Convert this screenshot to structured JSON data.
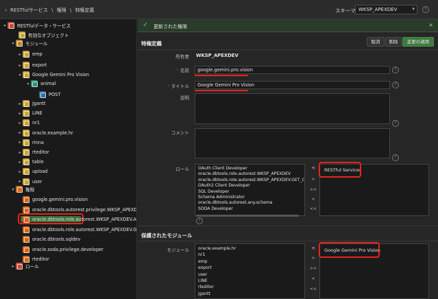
{
  "breadcrumb": {
    "items": [
      "RESTfulサービス",
      "権限",
      "特権定義"
    ]
  },
  "schema": {
    "label": "スキーマ",
    "value": "WKSP_APEXDEV"
  },
  "tree": {
    "root": "RESTfulデータ・サービス",
    "enabled_objects": "有効なオブジェクト",
    "modules_label": "モジュール",
    "modules": [
      "emp",
      "export",
      "Google Gemini Pro Vision"
    ],
    "template": "animal",
    "handler": "POST",
    "modules_after": [
      "jgantt",
      "LINE",
      "nr1",
      "oracle.example.hr",
      "rinna",
      "rteditor",
      "table",
      "upload",
      "user"
    ],
    "privileges_label": "権限",
    "privileges": [
      "google.gemini.pro.vision",
      "oracle.dbtools.autorest.privilege.WKSP_APEXDEV",
      "oracle.dbtools.role.autorest.WKSP_APEXDEV.AWS4",
      "oracle.dbtools.role.autorest.WKSP_APEXDEV.GET_C",
      "oracle.dbtools.sqldev",
      "oracle.soda.privilege.developer",
      "rteditor"
    ],
    "roles_label": "ロール"
  },
  "notification": {
    "message": "更新された権限",
    "close": "×"
  },
  "form": {
    "title": "特権定義",
    "buttons": {
      "cancel": "取消",
      "delete": "削除",
      "apply": "変更の適用"
    },
    "owner": {
      "label": "所有者",
      "value": "WKSP_APEXDEV"
    },
    "name": {
      "label": "名前",
      "value": "google.gemini.pro.vision"
    },
    "title_field": {
      "label": "タイトル",
      "value": "Google Gemini Pro Vision"
    },
    "description": {
      "label": "説明"
    },
    "comments": {
      "label": "コメント"
    },
    "roles": {
      "label": "ロール",
      "available": [
        "OAuth Client Developer",
        "oracle.dbtools.role.autorest.WKSP_APEXDEV",
        "oracle.dbtools.role.autorest.WKSP_APEXDEV.GET_CURRE",
        "OAuth2 Client Developer",
        "SQL Developer",
        "Schema Administrator",
        "oracle.dbtools.autorest.any.schema",
        "SODA Developer"
      ],
      "selected": "RESTful Services"
    },
    "protected": {
      "title": "保護されたモジュール",
      "label": "モジュール",
      "available": [
        "oracle.example.hr",
        "nr1",
        "emp",
        "export",
        "user",
        "LINE",
        "rteditor",
        "jgantt"
      ],
      "selected": "Google Gemini Pro Vision"
    }
  },
  "shuttle": {
    "reset": "⟲",
    "move": ">",
    "move_all": ">>",
    "remove": "<",
    "remove_all": "<<"
  },
  "icons": {
    "help": "?",
    "expand": "▾",
    "collapse": "▸"
  }
}
